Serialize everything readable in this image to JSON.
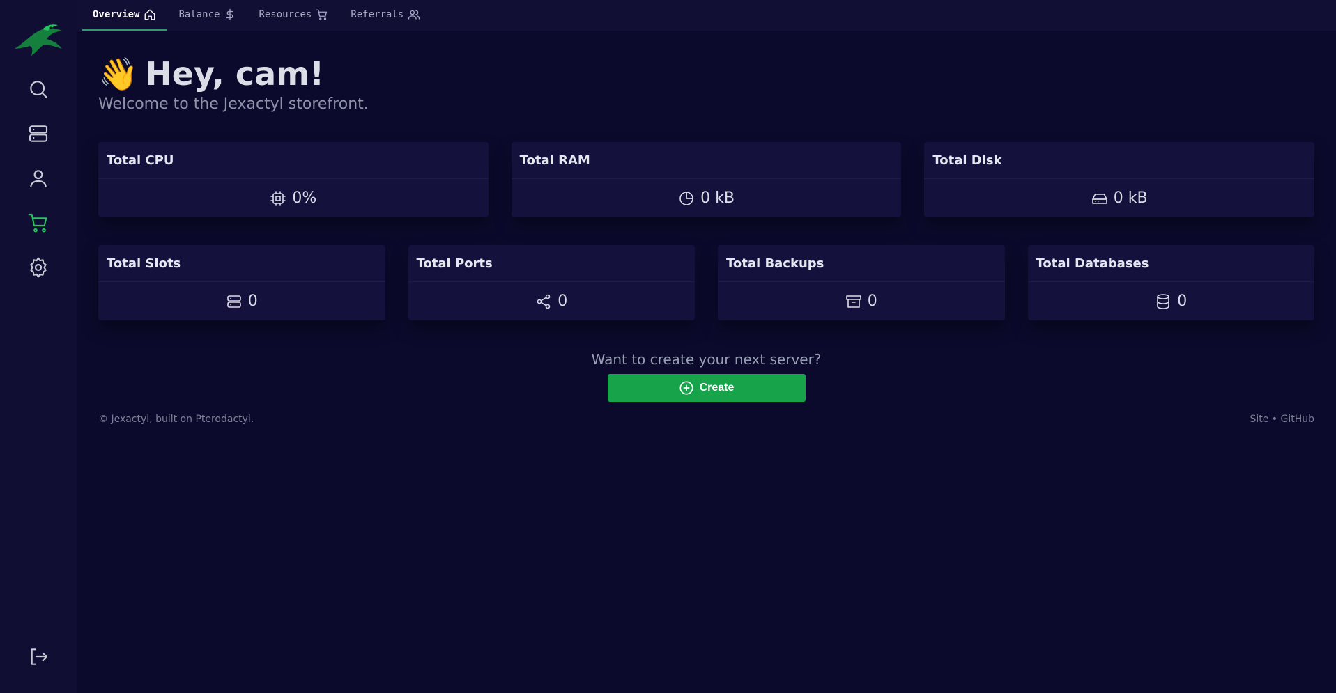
{
  "topnav": {
    "tabs": [
      {
        "label": "Overview",
        "icon": "home-icon"
      },
      {
        "label": "Balance",
        "icon": "dollar-icon"
      },
      {
        "label": "Resources",
        "icon": "cart-icon"
      },
      {
        "label": "Referrals",
        "icon": "users-icon"
      }
    ]
  },
  "sidebar": {
    "items": [
      "search-icon",
      "servers-icon",
      "account-icon",
      "store-icon",
      "settings-icon"
    ],
    "logout": "logout-icon",
    "active_color": "#22c55e"
  },
  "greeting": {
    "emoji": "👋",
    "title": "Hey, cam!",
    "subtitle": "Welcome to the Jexactyl storefront."
  },
  "stats_row1": [
    {
      "label": "Total CPU",
      "value": "0%",
      "icon": "cpu-icon"
    },
    {
      "label": "Total RAM",
      "value": "0 kB",
      "icon": "pie-chart-icon"
    },
    {
      "label": "Total Disk",
      "value": "0 kB",
      "icon": "hard-drive-icon"
    }
  ],
  "stats_row2": [
    {
      "label": "Total Slots",
      "value": "0",
      "icon": "server-icon"
    },
    {
      "label": "Total Ports",
      "value": "0",
      "icon": "share-icon"
    },
    {
      "label": "Total Backups",
      "value": "0",
      "icon": "archive-icon"
    },
    {
      "label": "Total Databases",
      "value": "0",
      "icon": "database-icon"
    }
  ],
  "cta": {
    "text": "Want to create your next server?",
    "button": "Create",
    "button_color": "#16a34a"
  },
  "footer": {
    "left": "© Jexactyl, built on Pterodactyl.",
    "right": "Site • GitHub"
  }
}
